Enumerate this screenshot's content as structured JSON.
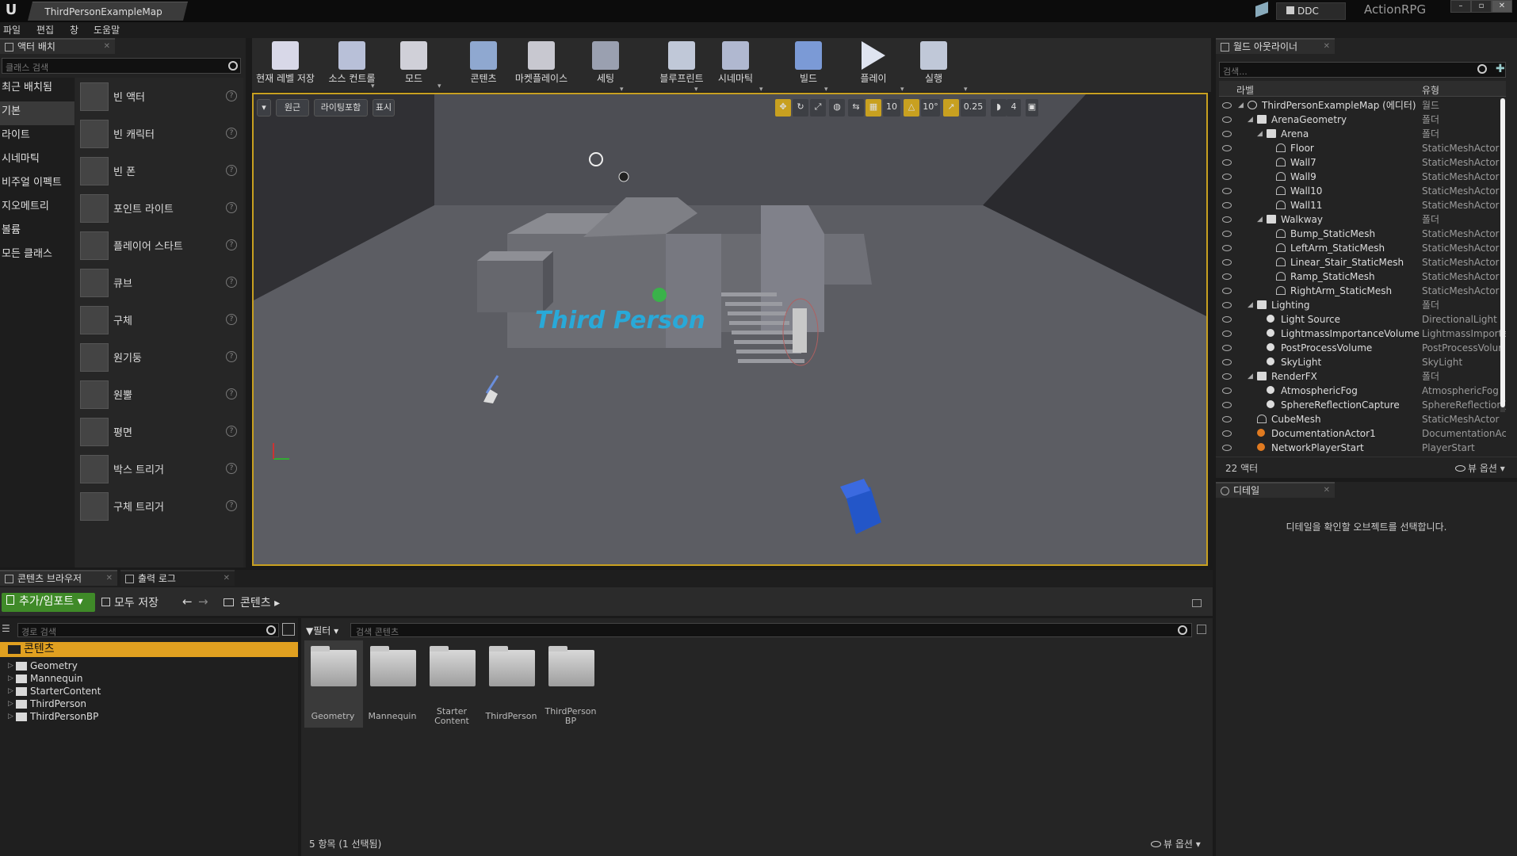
{
  "window": {
    "map_tab": "ThirdPersonExampleMap",
    "ddc": "DDC",
    "project": "ActionRPG"
  },
  "menu": [
    "파일",
    "편집",
    "창",
    "도움말"
  ],
  "left_panel": {
    "tab_label": "액터 배치",
    "search_placeholder": "클래스 검색",
    "categories": [
      {
        "label": "최근 배치됨"
      },
      {
        "label": "기본"
      },
      {
        "label": "라이트"
      },
      {
        "label": "시네마틱"
      },
      {
        "label": "비주얼 이펙트"
      },
      {
        "label": "지오메트리"
      },
      {
        "label": "볼륨"
      },
      {
        "label": "모든 클래스"
      }
    ],
    "actors": [
      {
        "label": "빈 액터",
        "help": "?"
      },
      {
        "label": "빈 캐릭터",
        "help": "?"
      },
      {
        "label": "빈 폰",
        "help": "?"
      },
      {
        "label": "포인트 라이트",
        "help": "?"
      },
      {
        "label": "플레이어 스타트",
        "help": "?"
      },
      {
        "label": "큐브",
        "help": "?"
      },
      {
        "label": "구체",
        "help": "?"
      },
      {
        "label": "원기둥",
        "help": "?"
      },
      {
        "label": "원뿔",
        "help": "?"
      },
      {
        "label": "평면",
        "help": "?"
      },
      {
        "label": "박스 트리거",
        "help": "?"
      },
      {
        "label": "구체 트리거",
        "help": "?"
      }
    ]
  },
  "toolbar": [
    {
      "label": "현재 레벨 저장",
      "icon": "save-icon"
    },
    {
      "label": "소스 컨트롤",
      "icon": "source-control-icon"
    },
    {
      "label": "모드",
      "icon": "modes-icon"
    },
    {
      "label": "콘텐츠",
      "icon": "content-icon"
    },
    {
      "label": "마켓플레이스",
      "icon": "marketplace-icon"
    },
    {
      "label": "세팅",
      "icon": "settings-icon"
    },
    {
      "label": "블루프린트",
      "icon": "blueprint-icon"
    },
    {
      "label": "시네마틱",
      "icon": "cinematics-icon"
    },
    {
      "label": "빌드",
      "icon": "build-icon"
    },
    {
      "label": "플레이",
      "icon": "play-icon"
    },
    {
      "label": "실행",
      "icon": "launch-icon"
    }
  ],
  "viewport": {
    "perspective": "원근",
    "lit": "라이팅포함",
    "show": "표시",
    "grid_snap": "10",
    "rot_snap": "10°",
    "scale_snap": "0.25",
    "cam_speed": "4",
    "scene_text": "Third Person",
    "accent": "#c8a020"
  },
  "outliner": {
    "tab_label": "월드 아웃라이너",
    "search_placeholder": "검색...",
    "col_label": "라벨",
    "col_type": "유형",
    "rows": [
      {
        "label": "ThirdPersonExampleMap (에디터)",
        "type": "월드"
      },
      {
        "label": "ArenaGeometry",
        "type": "폴더"
      },
      {
        "label": "Arena",
        "type": "폴더"
      },
      {
        "label": "Floor",
        "type": "StaticMeshActor"
      },
      {
        "label": "Wall7",
        "type": "StaticMeshActor"
      },
      {
        "label": "Wall9",
        "type": "StaticMeshActor"
      },
      {
        "label": "Wall10",
        "type": "StaticMeshActor"
      },
      {
        "label": "Wall11",
        "type": "StaticMeshActor"
      },
      {
        "label": "Walkway",
        "type": "폴더"
      },
      {
        "label": "Bump_StaticMesh",
        "type": "StaticMeshActor"
      },
      {
        "label": "LeftArm_StaticMesh",
        "type": "StaticMeshActor"
      },
      {
        "label": "Linear_Stair_StaticMesh",
        "type": "StaticMeshActor"
      },
      {
        "label": "Ramp_StaticMesh",
        "type": "StaticMeshActor"
      },
      {
        "label": "RightArm_StaticMesh",
        "type": "StaticMeshActor"
      },
      {
        "label": "Lighting",
        "type": "폴더"
      },
      {
        "label": "Light Source",
        "type": "DirectionalLight"
      },
      {
        "label": "LightmassImportanceVolume",
        "type": "LightmassImporta"
      },
      {
        "label": "PostProcessVolume",
        "type": "PostProcessVolur"
      },
      {
        "label": "SkyLight",
        "type": "SkyLight"
      },
      {
        "label": "RenderFX",
        "type": "폴더"
      },
      {
        "label": "AtmosphericFog",
        "type": "AtmosphericFog"
      },
      {
        "label": "SphereReflectionCapture",
        "type": "SphereReflection("
      },
      {
        "label": "CubeMesh",
        "type": "StaticMeshActor"
      },
      {
        "label": "DocumentationActor1",
        "type": "DocumentationAc"
      },
      {
        "label": "NetworkPlayerStart",
        "type": "PlayerStart"
      }
    ],
    "count": "22 액터",
    "view_options": "뷰 옵션"
  },
  "details": {
    "tab_label": "디테일",
    "empty_msg": "디테일을 확인할 오브젝트를 선택합니다."
  },
  "content_browser": {
    "tab_label": "콘텐츠 브라우저",
    "output_tab": "출력 로그",
    "add_import": "추가/임포트",
    "save_all": "모두 저장",
    "path": "콘텐츠",
    "path_search": "경로 검색",
    "filter": "필터",
    "search_placeholder": "검색 콘텐츠",
    "tree_root": "콘텐츠",
    "tree": [
      "Geometry",
      "Mannequin",
      "StarterContent",
      "ThirdPerson",
      "ThirdPersonBP"
    ],
    "tiles": [
      {
        "line1": "Geometry",
        "line2": ""
      },
      {
        "line1": "Mannequin",
        "line2": ""
      },
      {
        "line1": "Starter",
        "line2": "Content"
      },
      {
        "line1": "ThirdPerson",
        "line2": ""
      },
      {
        "line1": "ThirdPerson",
        "line2": "BP"
      }
    ],
    "status": "5 항목 (1 선택됨)",
    "view_options": "뷰 옵션",
    "accent_green": "#3f8a28",
    "selected_color": "#e0a020"
  }
}
